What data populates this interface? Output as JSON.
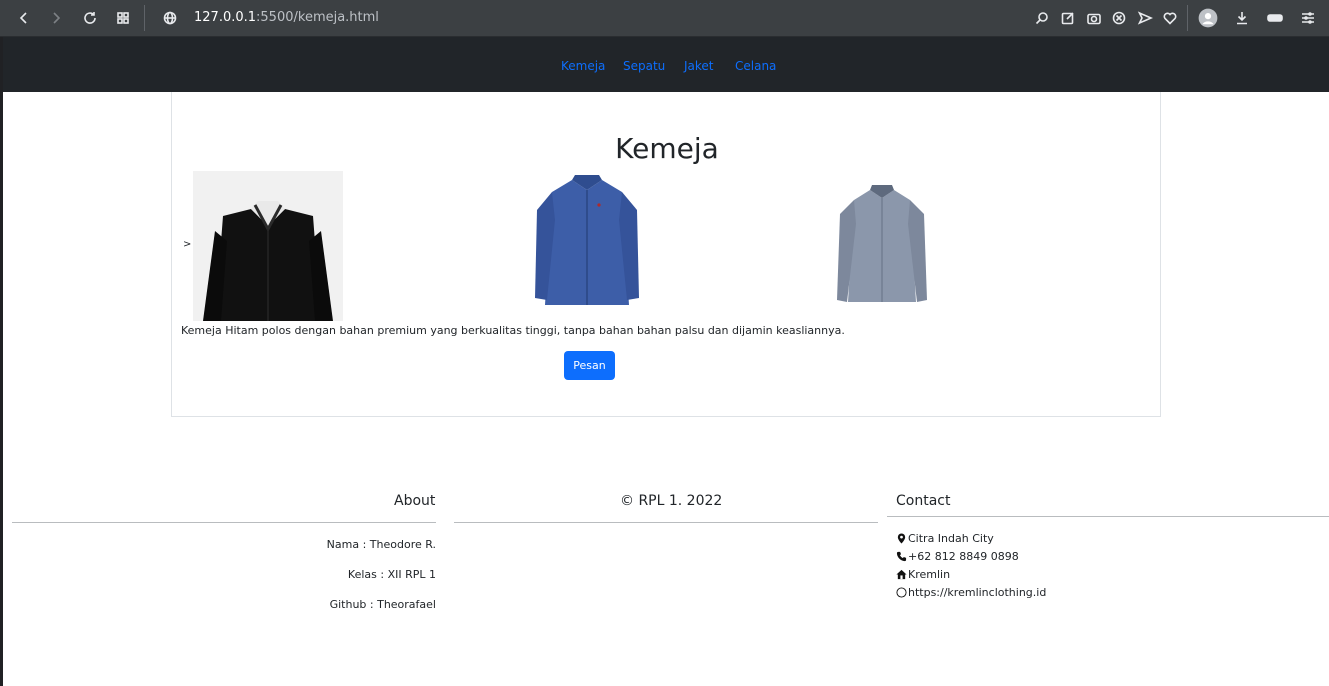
{
  "browser": {
    "url_host": "127.0.0.1",
    "url_rest": ":5500/kemeja.html"
  },
  "navbar": {
    "links": [
      "Kemeja",
      "Sepatu",
      "Jaket",
      "Celana"
    ]
  },
  "main": {
    "title": "Kemeja",
    "stray_char": ">",
    "description": "Kemeja Hitam polos dengan bahan premium yang berkualitas tinggi, tanpa bahan bahan palsu dan dijamin keasliannya.",
    "order_button": "Pesan",
    "products": [
      {
        "name": "black-shirt-image",
        "color": "#111111"
      },
      {
        "name": "blue-shirt-image",
        "color": "#3d5ea8"
      },
      {
        "name": "gray-shirt-image",
        "color": "#8b97ab"
      }
    ]
  },
  "footer": {
    "about": {
      "heading": "About",
      "name": "Nama : Theodore R.",
      "class": "Kelas : XII RPL 1",
      "github": "Github : Theorafael"
    },
    "copyright": "© RPL 1. 2022",
    "contact": {
      "heading": "Contact",
      "address": "Citra Indah City",
      "phone": "+62 812 8849 0898",
      "store": "Kremlin",
      "website": "https://kremlinclothing.id"
    }
  },
  "colors": {
    "navbar_bg": "#212529",
    "link": "#0d6efd",
    "button": "#0d6efd",
    "browser_bar": "#3c4043"
  }
}
